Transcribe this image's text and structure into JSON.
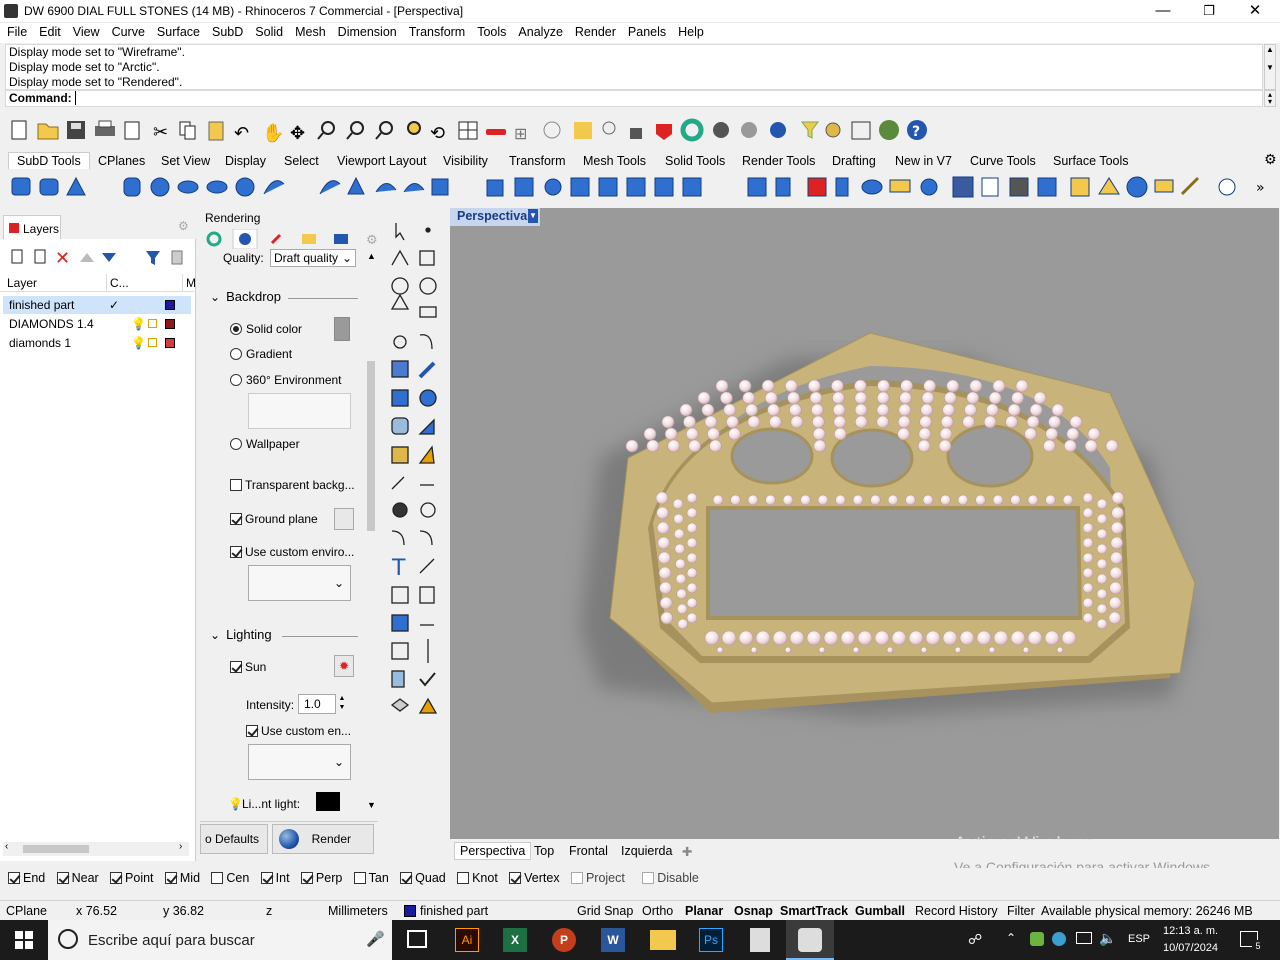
{
  "window": {
    "title": "DW 6900 DIAL FULL STONES (14 MB) - Rhinoceros 7 Commercial - [Perspectiva]",
    "minimize": "—",
    "restore": "❐",
    "close": "✕"
  },
  "menu": [
    "File",
    "Edit",
    "View",
    "Curve",
    "Surface",
    "SubD",
    "Solid",
    "Mesh",
    "Dimension",
    "Transform",
    "Tools",
    "Analyze",
    "Render",
    "Panels",
    "Help"
  ],
  "history": [
    "Display mode set to \"Wireframe\".",
    "Display mode set to \"Arctic\".",
    "Display mode set to \"Rendered\"."
  ],
  "command": {
    "label": "Command:",
    "value": ""
  },
  "toolbar_tabs": [
    "SubD Tools",
    "CPlanes",
    "Set View",
    "Display",
    "Select",
    "Viewport Layout",
    "Visibility",
    "Transform",
    "Mesh Tools",
    "Solid Tools",
    "Render Tools",
    "Drafting",
    "New in V7",
    "Curve Tools",
    "Surface Tools"
  ],
  "layers": {
    "tab": "Layers",
    "headers": {
      "layer": "Layer",
      "current": "C...",
      "material": "M"
    },
    "rows": [
      {
        "name": "finished part",
        "current": "✓",
        "color": "#1a1aa0"
      },
      {
        "name": "DIAMONDS 1.4",
        "current": "",
        "color": "#8b1a1a"
      },
      {
        "name": "diamonds 1",
        "current": "",
        "color": "#d23c3c"
      }
    ]
  },
  "rendering": {
    "title": "Rendering",
    "quality_label": "Quality:",
    "quality_value": "Draft quality",
    "backdrop": "Backdrop",
    "solid_color": "Solid color",
    "gradient": "Gradient",
    "env360": "360° Environment",
    "wallpaper": "Wallpaper",
    "transparent": "Transparent backg...",
    "ground_plane": "Ground plane",
    "custom_env": "Use custom enviro...",
    "lighting": "Lighting",
    "sun": "Sun",
    "intensity_label": "Intensity:",
    "intensity_value": "1.0",
    "custom_env2": "Use custom en...",
    "light_label": "Li...nt light:",
    "defaults_btn": "o Defaults",
    "render_btn": "Render"
  },
  "viewport": {
    "label": "Perspectiva",
    "tabs": [
      "Perspectiva",
      "Top",
      "Frontal",
      "Izquierda"
    ],
    "watermark_title": "Activar Windows",
    "watermark_sub": "Ve a Configuración para activar Windows."
  },
  "osnap": [
    {
      "label": "End",
      "on": true
    },
    {
      "label": "Near",
      "on": true
    },
    {
      "label": "Point",
      "on": true
    },
    {
      "label": "Mid",
      "on": true
    },
    {
      "label": "Cen",
      "on": false
    },
    {
      "label": "Int",
      "on": true
    },
    {
      "label": "Perp",
      "on": true
    },
    {
      "label": "Tan",
      "on": false
    },
    {
      "label": "Quad",
      "on": true
    },
    {
      "label": "Knot",
      "on": false
    },
    {
      "label": "Vertex",
      "on": true
    },
    {
      "label": "Project",
      "on": false
    },
    {
      "label": "Disable",
      "on": false
    }
  ],
  "status": {
    "cplane": "CPlane",
    "x": "x 76.52",
    "y": "y 36.82",
    "z": "z",
    "units": "Millimeters",
    "layer": "finished part",
    "grid_snap": "Grid Snap",
    "ortho": "Ortho",
    "planar": "Planar",
    "osnap": "Osnap",
    "smarttrack": "SmartTrack",
    "gumball": "Gumball",
    "record_history": "Record History",
    "filter": "Filter",
    "memory": "Available physical memory: 26246 MB"
  },
  "taskbar": {
    "search": "Escribe aquí para buscar",
    "lang": "ESP",
    "time": "12:13 a. m.",
    "date": "10/07/2024",
    "notif": "5"
  },
  "colors": {
    "accent": "#0078d7",
    "part": "#c8b47a",
    "gem": "#f3dde1",
    "viewport_bg": "#9a9a9a"
  }
}
